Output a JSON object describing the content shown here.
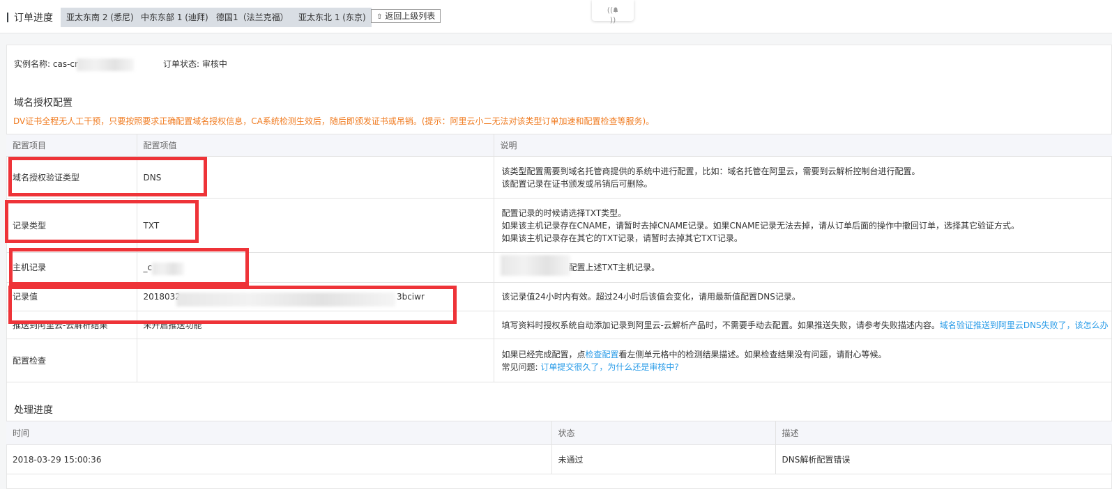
{
  "header": {
    "title": "订单进度",
    "regions": [
      "亚太东南 2 (悉尼)",
      "中东东部 1 (迪拜)",
      "德国1（法兰克福）",
      "亚太东北 1 (东京)"
    ],
    "back_label": "返回上级列表",
    "back_icon": "arrow-up-icon",
    "notification_icon": "bell-icon"
  },
  "instance": {
    "name_label": "实例名称:",
    "name_value": "cas-cr",
    "status_label": "订单状态:",
    "status_value": "审核中"
  },
  "domain_config": {
    "title": "域名授权配置",
    "notice": "DV证书全程无人工干预，只要按照要求正确配置域名授权信息，CA系统检测生效后，随后即颁发证书或吊销。(提示：阿里云小二无法对该类型订单加速和配置检查等服务)。",
    "columns": [
      "配置项目",
      "配置项值",
      "说明"
    ],
    "rows": [
      {
        "item": "域名授权验证类型",
        "value": "DNS",
        "desc": [
          "该类型配置需要到域名托管商提供的系统中进行配置，比如：域名托管在阿里云，需要到云解析控制台进行配置。",
          "该配置记录在证书颁发或吊销后可删除。"
        ]
      },
      {
        "item": "记录类型",
        "value": "TXT",
        "desc": [
          "配置记录的时候请选择TXT类型。",
          "如果该主机记录存在CNAME，请暂时去掉CNAME记录。如果CNAME记录无法去掉，请从订单后面的操作中撤回订单，选择其它验证方式。",
          "如果该主机记录存在其它的TXT记录，请暂时去掉其它TXT记录。"
        ]
      },
      {
        "item": "主机记录",
        "value": "_c",
        "desc": [
          "下配置上述TXT主机记录。"
        ]
      },
      {
        "item": "记录值",
        "value_prefix": "2018032",
        "value_suffix": "3bciwr",
        "desc": [
          "该记录值24小时内有效。超过24小时后该值会变化，请用最新值配置DNS记录。"
        ]
      },
      {
        "item": "推送到阿里云-云解析结果",
        "value": "未开启推送功能",
        "desc_text": "填写资料时授权系统自动添加记录到阿里云-云解析产品时，不需要手动去配置。如果推送失败，请参考失败描述内容。",
        "desc_link": "域名验证推送到阿里云DNS失败了，该怎么办"
      },
      {
        "item": "配置检查",
        "value": "",
        "desc_pre": "如果已经完成配置，点",
        "desc_link1": "检查配置",
        "desc_post": "看左侧单元格中的检测结果描述。如果检查结果没有问题，请耐心等候。",
        "faq_label": "常见问题:",
        "faq_link": "订单提交很久了，为什么还是审核中?"
      }
    ]
  },
  "progress": {
    "title": "处理进度",
    "columns": [
      "时间",
      "状态",
      "描述"
    ],
    "rows": [
      {
        "time": "2018-03-29 15:00:36",
        "status": "未通过",
        "desc": "DNS解析配置错误"
      }
    ]
  },
  "colors": {
    "accent_link": "#2a9ce8",
    "notice_orange": "#f07c22",
    "annotation_red": "#ee3338",
    "tab_bg": "#d9dee4"
  }
}
